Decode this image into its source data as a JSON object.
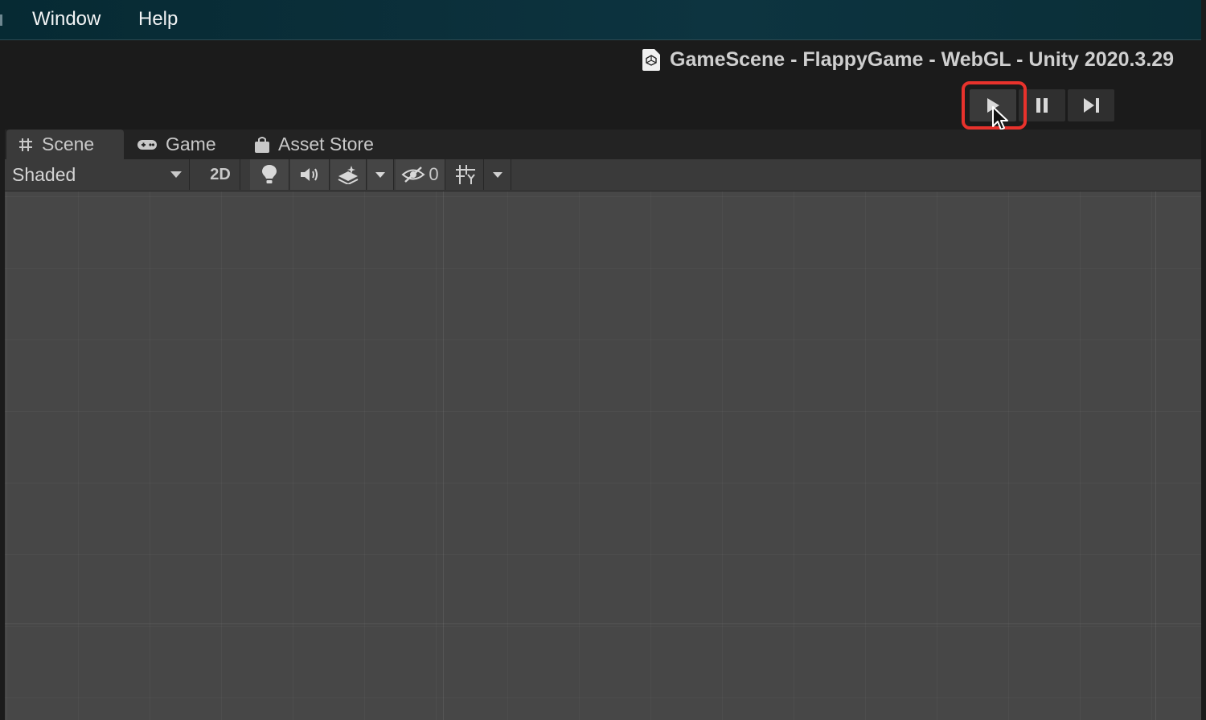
{
  "menubar": {
    "items": [
      {
        "label": "Window"
      },
      {
        "label": "Help"
      }
    ]
  },
  "titlebar": {
    "title": "GameScene - FlappyGame - WebGL - Unity 2020.3.29"
  },
  "playback": {
    "buttons": [
      {
        "icon": "play-icon",
        "highlighted": true
      },
      {
        "icon": "pause-icon"
      },
      {
        "icon": "step-icon"
      }
    ],
    "highlight_color": "#e8322c"
  },
  "tabs": [
    {
      "label": "Scene",
      "icon": "grid-hash-icon",
      "active": true
    },
    {
      "label": "Game",
      "icon": "gamepad-icon"
    },
    {
      "label": "Asset Store",
      "icon": "shopping-bag-icon"
    }
  ],
  "toolbar": {
    "draw_mode": "Shaded",
    "mode_2d": "2D",
    "hidden_count": "0"
  }
}
